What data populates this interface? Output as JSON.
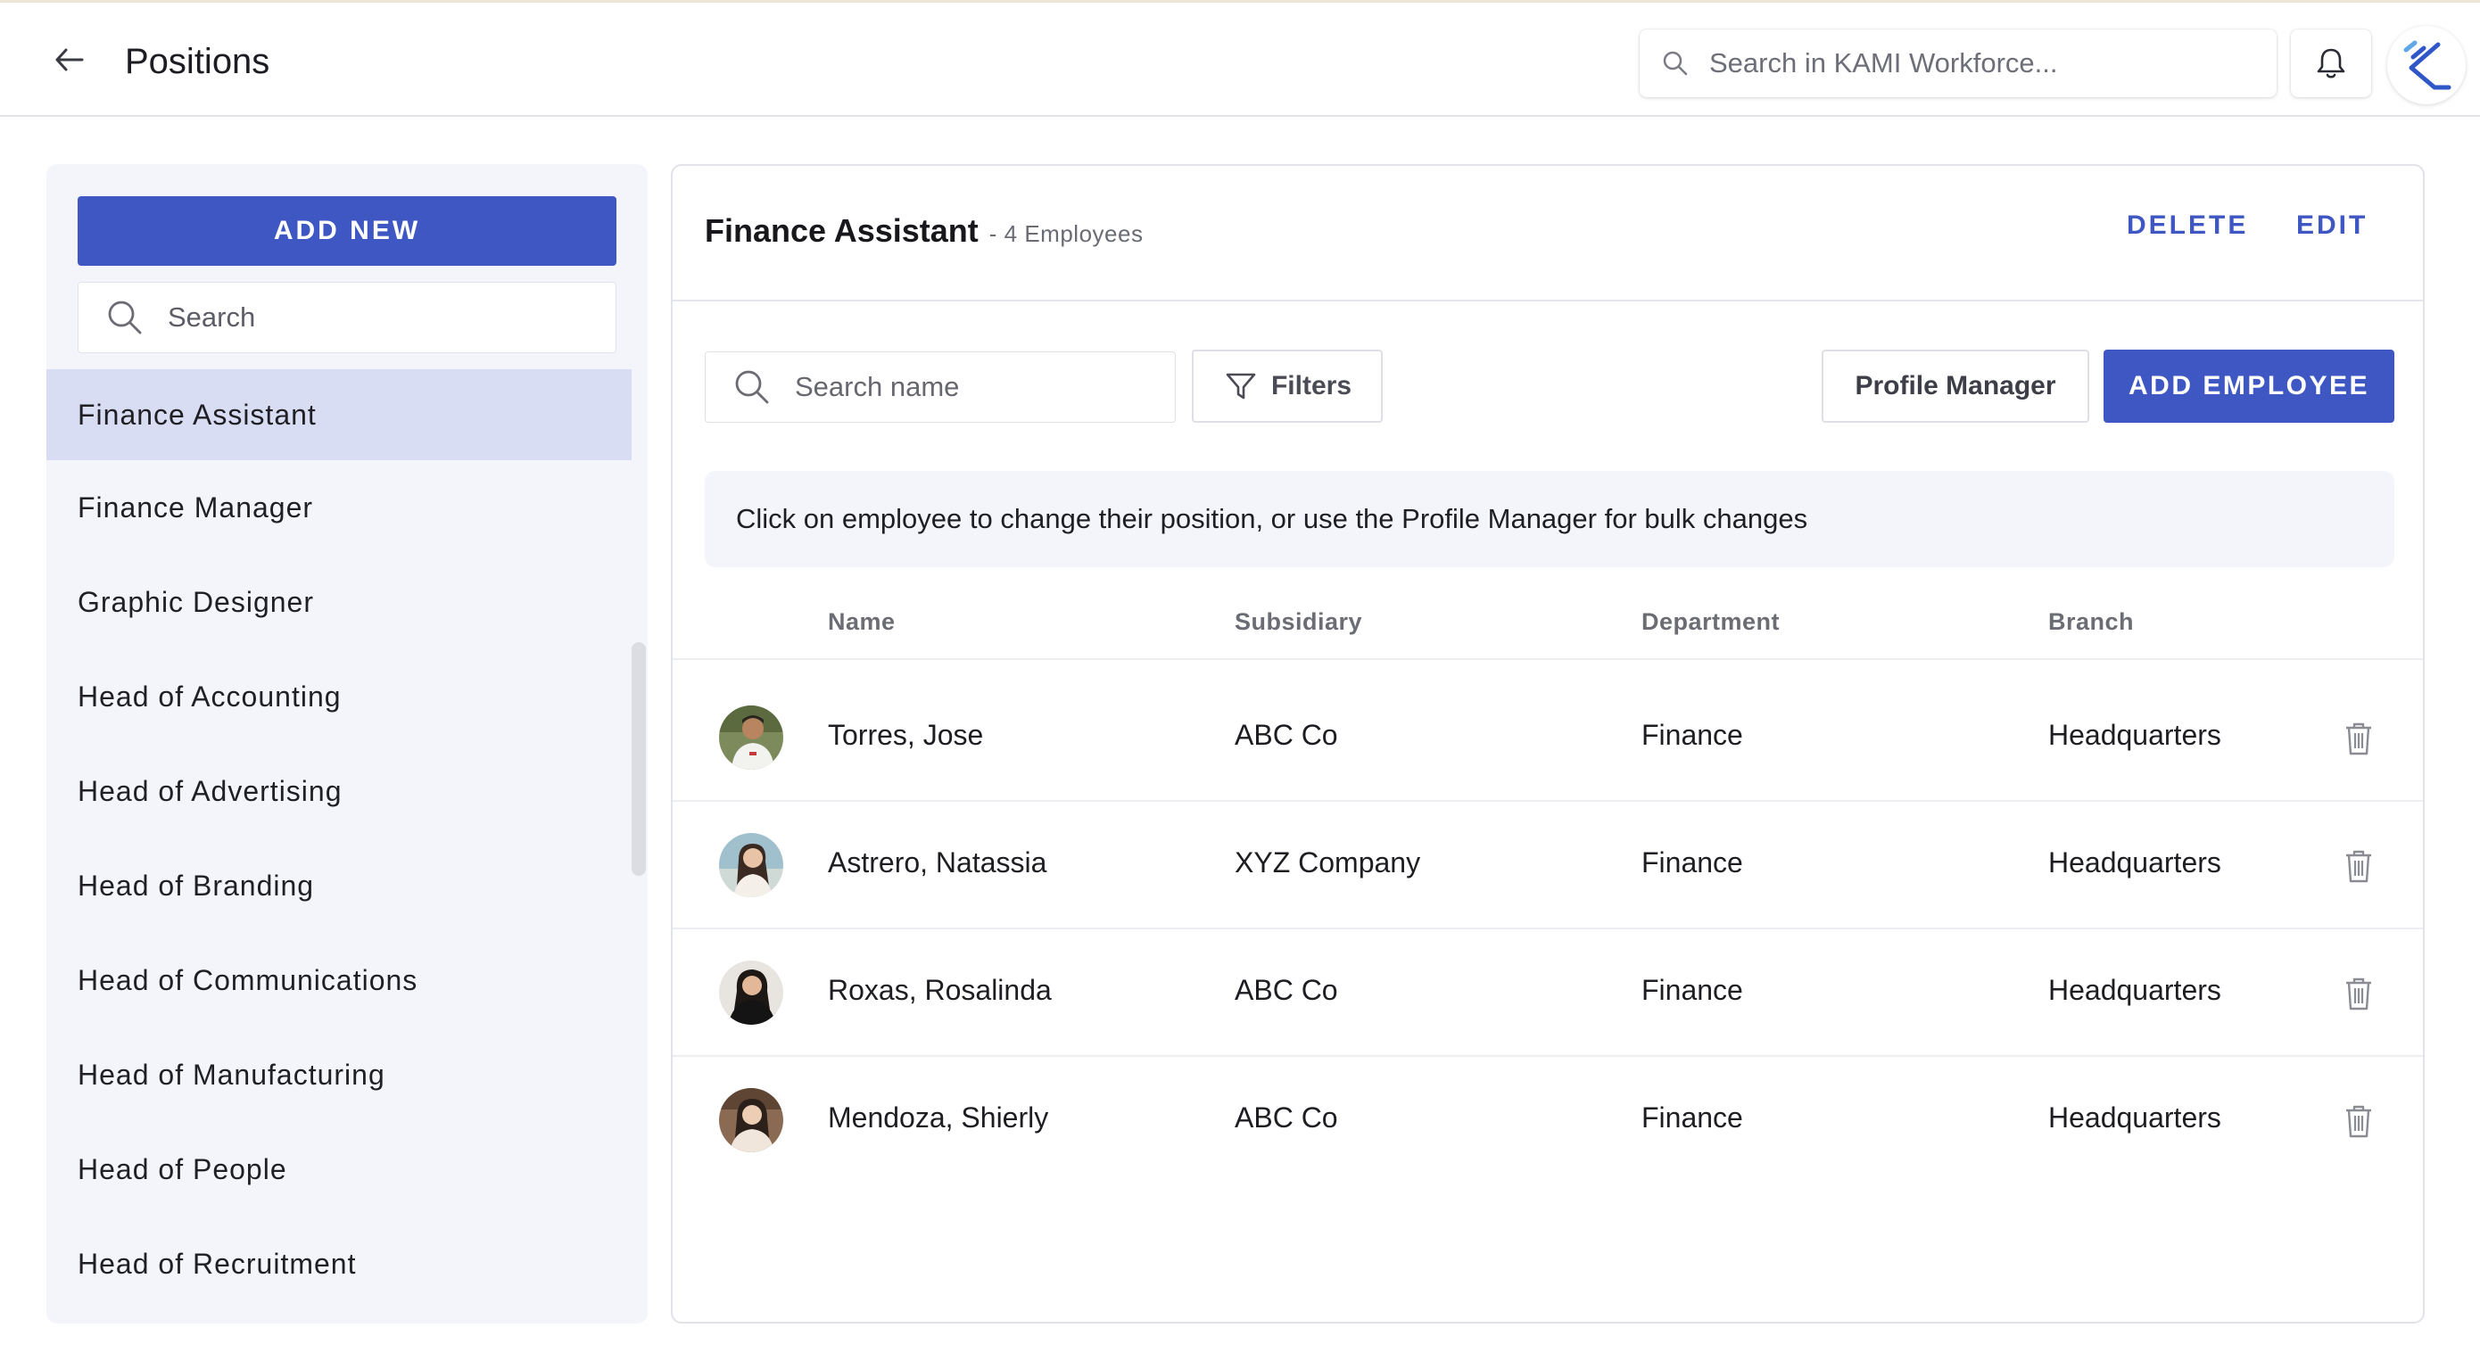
{
  "header": {
    "title": "Positions",
    "search_placeholder": "Search in KAMI Workforce..."
  },
  "sidebar": {
    "add_new_label": "ADD NEW",
    "search_placeholder": "Search",
    "positions": [
      "Finance Assistant",
      "Finance Manager",
      "Graphic Designer",
      "Head of Accounting",
      "Head of Advertising",
      "Head of Branding",
      "Head of Communications",
      "Head of Manufacturing",
      "Head of People",
      "Head of Recruitment"
    ],
    "active_index": 0
  },
  "main": {
    "position_title": "Finance Assistant",
    "employee_count": "- 4 Employees",
    "delete_label": "DELETE",
    "edit_label": "EDIT",
    "search_placeholder": "Search name",
    "filters_label": "Filters",
    "profile_manager_label": "Profile Manager",
    "add_employee_label": "ADD EMPLOYEE",
    "info_text": "Click on employee to change their position, or use the Profile Manager for bulk changes",
    "columns": {
      "name": "Name",
      "subsidiary": "Subsidiary",
      "department": "Department",
      "branch": "Branch"
    },
    "employees": [
      {
        "name": "Torres, Jose",
        "subsidiary": "ABC Co",
        "department": "Finance",
        "branch": "Headquarters"
      },
      {
        "name": "Astrero, Natassia",
        "subsidiary": "XYZ Company",
        "department": "Finance",
        "branch": "Headquarters"
      },
      {
        "name": "Roxas, Rosalinda",
        "subsidiary": "ABC Co",
        "department": "Finance",
        "branch": "Headquarters"
      },
      {
        "name": "Mendoza, Shierly",
        "subsidiary": "ABC Co",
        "department": "Finance",
        "branch": "Headquarters"
      }
    ]
  },
  "colors": {
    "primary": "#3f57c2",
    "sidebar_bg": "#f4f5fb",
    "active_item_bg": "#d8ddf3"
  }
}
